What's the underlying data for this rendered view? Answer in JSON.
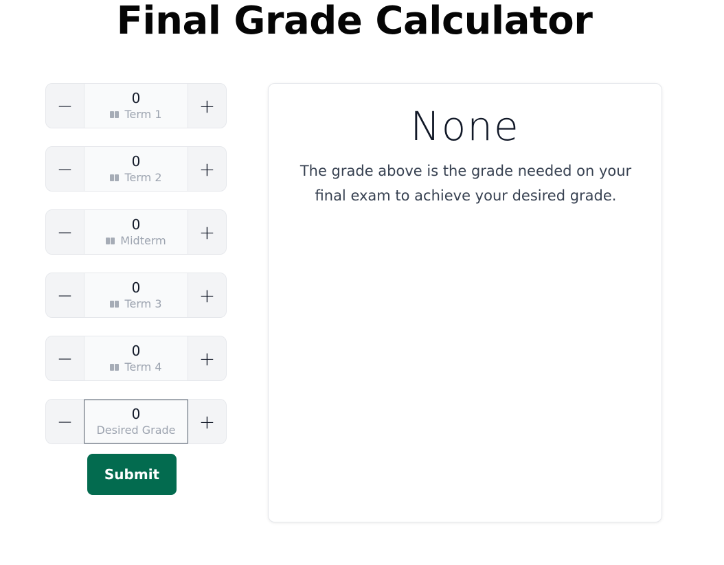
{
  "page": {
    "title": "Final Grade Calculator"
  },
  "steppers": [
    {
      "value": "0",
      "label": "Term 1",
      "has_icon": true
    },
    {
      "value": "0",
      "label": "Term 2",
      "has_icon": true
    },
    {
      "value": "0",
      "label": "Midterm",
      "has_icon": true
    },
    {
      "value": "0",
      "label": "Term 3",
      "has_icon": true
    },
    {
      "value": "0",
      "label": "Term 4",
      "has_icon": true
    },
    {
      "value": "0",
      "label": "Desired Grade",
      "has_icon": false
    }
  ],
  "stepper_controls": {
    "decrement_symbol": "−",
    "increment_symbol": "+"
  },
  "submit": {
    "label": "Submit",
    "color": "#036b4f"
  },
  "result": {
    "value": "None",
    "note": "The grade above is the grade needed on your final exam to achieve your desired grade."
  }
}
